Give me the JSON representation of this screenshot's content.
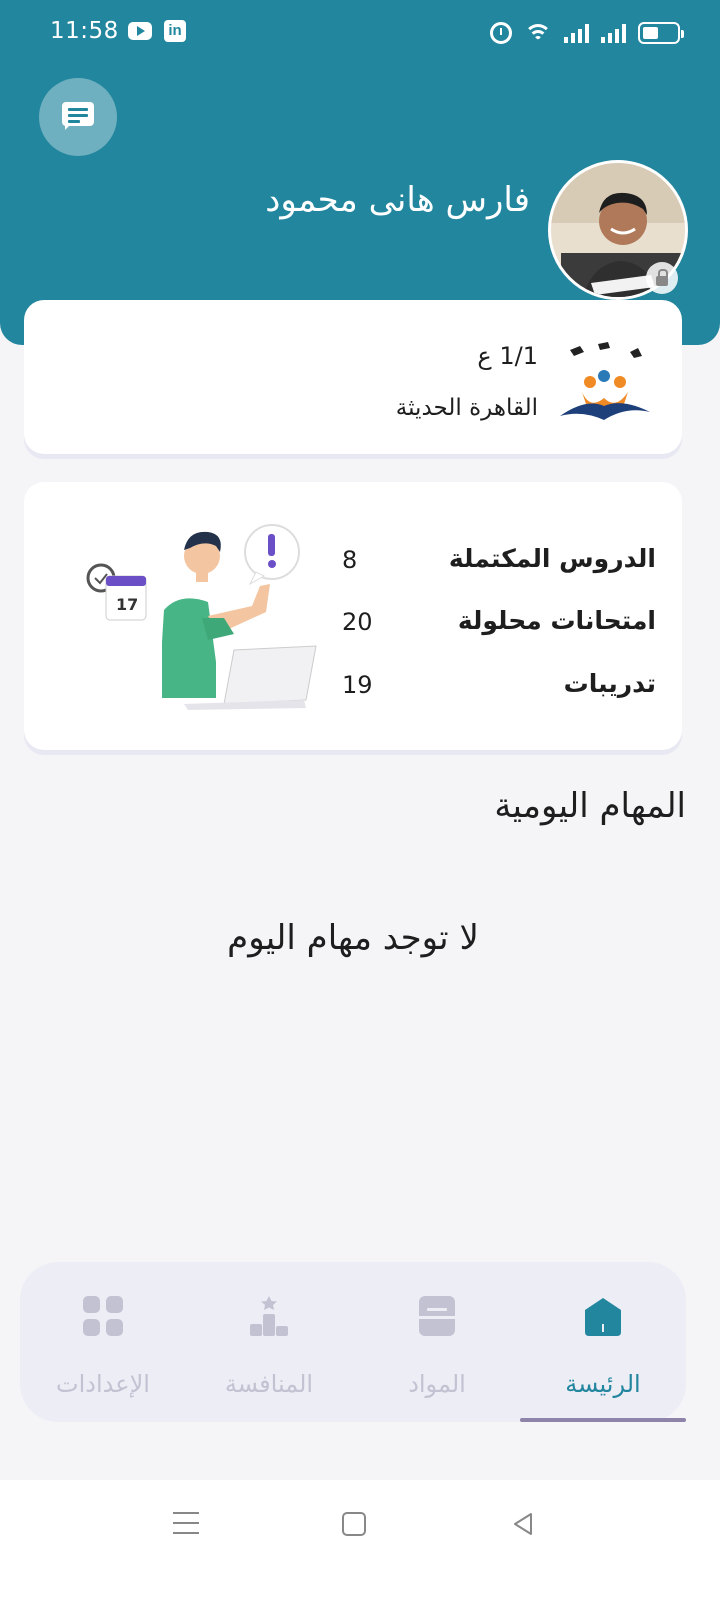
{
  "status_bar": {
    "time": "11:58",
    "icons": [
      "youtube-icon",
      "linkedin-icon",
      "alarm-icon",
      "wifi-icon",
      "signal-icon",
      "signal-icon",
      "battery-icon"
    ]
  },
  "header": {
    "user_name": "فارس هانى محمود",
    "chat_icon": "chat-icon",
    "avatar_icon": "avatar"
  },
  "school": {
    "class": "1/1 ع",
    "name": "القاهرة الحديثة"
  },
  "stats": [
    {
      "label": "الدروس المكتملة",
      "value": "8"
    },
    {
      "label": "امتحانات محلولة",
      "value": "20"
    },
    {
      "label": "تدريبات",
      "value": "19"
    }
  ],
  "daily_tasks": {
    "title": "المهام اليومية",
    "empty_message": "لا توجد مهام اليوم"
  },
  "bottom_nav": {
    "items": [
      {
        "label": "الرئيسة",
        "icon": "home-icon",
        "active": true
      },
      {
        "label": "المواد",
        "icon": "subjects-icon",
        "active": false
      },
      {
        "label": "المنافسة",
        "icon": "leaderboard-icon",
        "active": false
      },
      {
        "label": "الإعدادات",
        "icon": "settings-grid-icon",
        "active": false
      }
    ]
  },
  "colors": {
    "primary": "#22869e",
    "background": "#f5f5f7",
    "nav_background": "#ededf6",
    "nav_inactive": "#c2c2d2",
    "accent_orange": "#f08a24",
    "accent_purple": "#6a4fc6"
  }
}
